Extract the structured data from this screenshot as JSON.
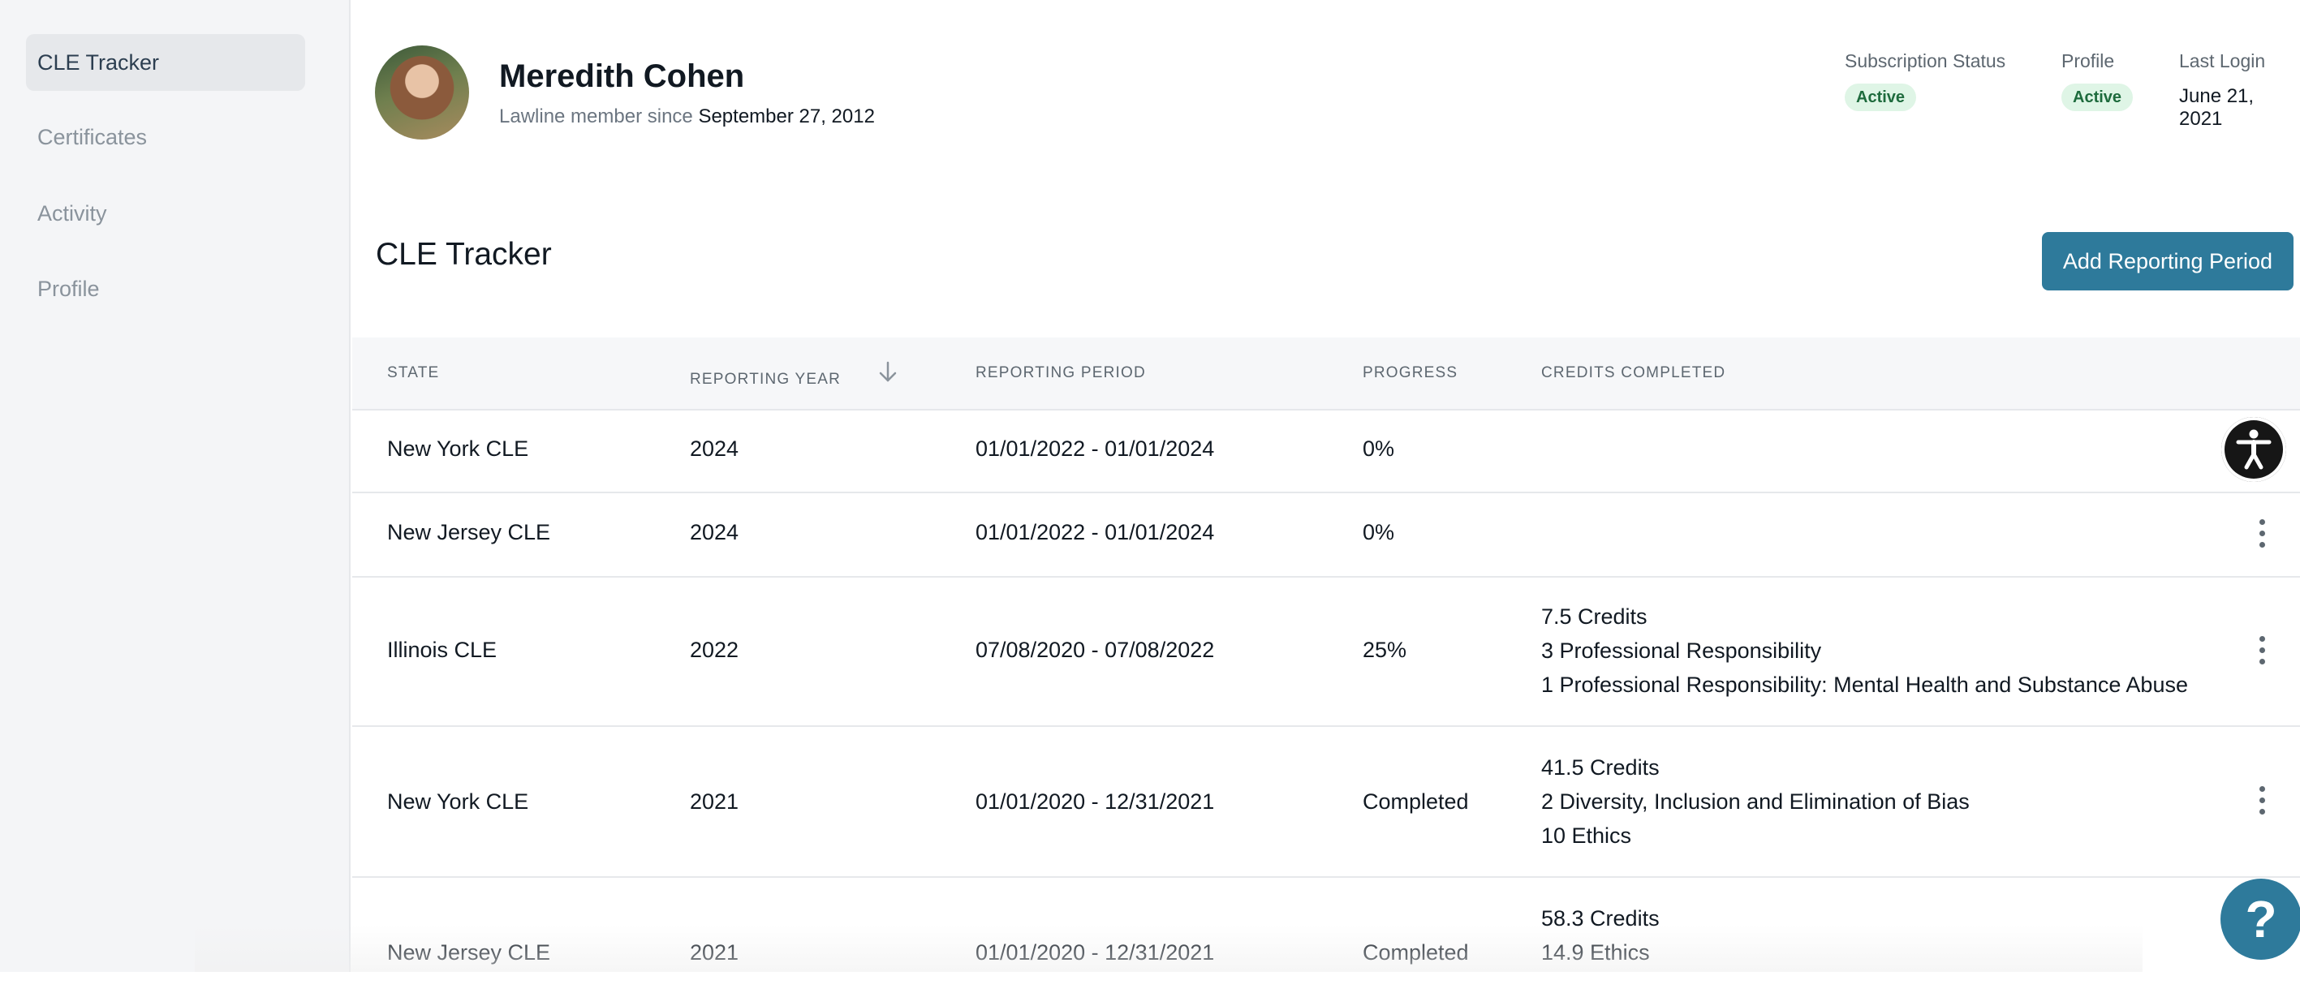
{
  "sidebar": {
    "items": [
      {
        "label": "CLE Tracker",
        "active": true
      },
      {
        "label": "Certificates",
        "active": false
      },
      {
        "label": "Activity",
        "active": false
      },
      {
        "label": "Profile",
        "active": false
      }
    ]
  },
  "user": {
    "name": "Meredith Cohen",
    "member_since_label": "Lawline member since",
    "member_since_date": "September 27, 2012"
  },
  "meta": {
    "subscription_label": "Subscription Status",
    "subscription_value": "Active",
    "profile_label": "Profile",
    "profile_value": "Active",
    "last_login_label": "Last Login",
    "last_login_value": "June 21, 2021"
  },
  "page": {
    "title": "CLE Tracker",
    "add_button": "Add Reporting Period"
  },
  "table": {
    "columns": {
      "state": "STATE",
      "year": "REPORTING YEAR",
      "period": "REPORTING PERIOD",
      "progress": "PROGRESS",
      "credits": "CREDITS COMPLETED"
    },
    "rows": [
      {
        "state": "New York CLE",
        "year": "2024",
        "period": "01/01/2022 - 01/01/2024",
        "progress": "0%",
        "credits": []
      },
      {
        "state": "New Jersey CLE",
        "year": "2024",
        "period": "01/01/2022 - 01/01/2024",
        "progress": "0%",
        "credits": []
      },
      {
        "state": "Illinois CLE",
        "year": "2022",
        "period": "07/08/2020 - 07/08/2022",
        "progress": "25%",
        "credits": [
          "7.5 Credits",
          "3 Professional Responsibility",
          "1 Professional Responsibility: Mental Health and Substance Abuse"
        ]
      },
      {
        "state": "New York CLE",
        "year": "2021",
        "period": "01/01/2020 - 12/31/2021",
        "progress": "Completed",
        "credits": [
          "41.5 Credits",
          "2 Diversity, Inclusion and Elimination of Bias",
          "10 Ethics"
        ]
      },
      {
        "state": "New Jersey CLE",
        "year": "2021",
        "period": "01/01/2020 - 12/31/2021",
        "progress": "Completed",
        "credits": [
          "58.3 Credits",
          "14.9 Ethics"
        ]
      }
    ]
  },
  "icons": {
    "sort": "arrow-down-icon",
    "row_menu": "kebab-menu-icon",
    "accessibility": "accessibility-icon",
    "help": "help-icon"
  },
  "colors": {
    "primary": "#2e7a9b",
    "badge_bg": "#dff5e6",
    "badge_text": "#1e6b3d",
    "sidebar_bg": "#f4f5f7"
  }
}
